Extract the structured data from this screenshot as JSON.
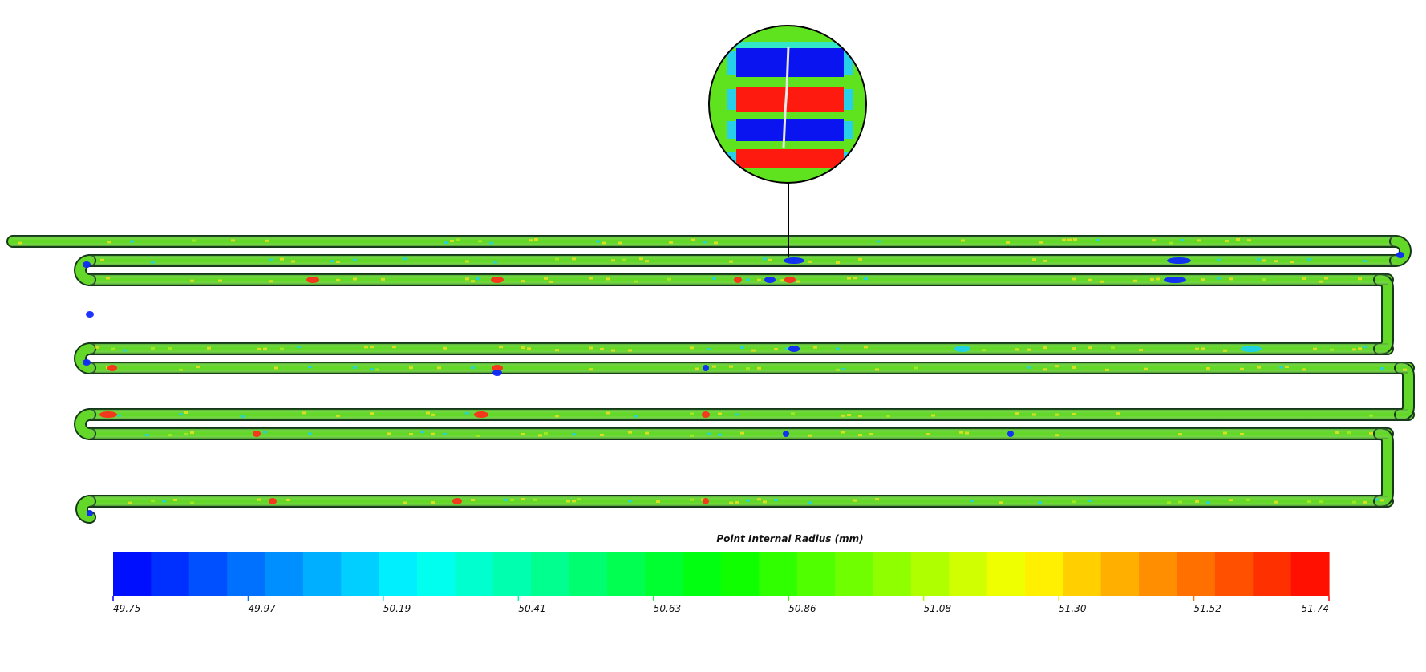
{
  "colorbar": {
    "title": "Point Internal Radius (mm)",
    "min": 49.75,
    "max": 51.74,
    "ticks": [
      "49.75",
      "49.97",
      "50.19",
      "50.41",
      "50.63",
      "50.86",
      "51.08",
      "51.30",
      "51.52",
      "51.74"
    ],
    "bands": 32,
    "colormap": [
      "#0000ff",
      "#00ffff",
      "#00ff00",
      "#ffff00",
      "#ff0000"
    ]
  },
  "colors": {
    "pipe_base": "#63d829",
    "pipe_outline": "#16381a",
    "low": "#0a24ff",
    "mid_low": "#19d2f0",
    "high": "#ff2a1a",
    "warm": "#f2e21b"
  }
}
